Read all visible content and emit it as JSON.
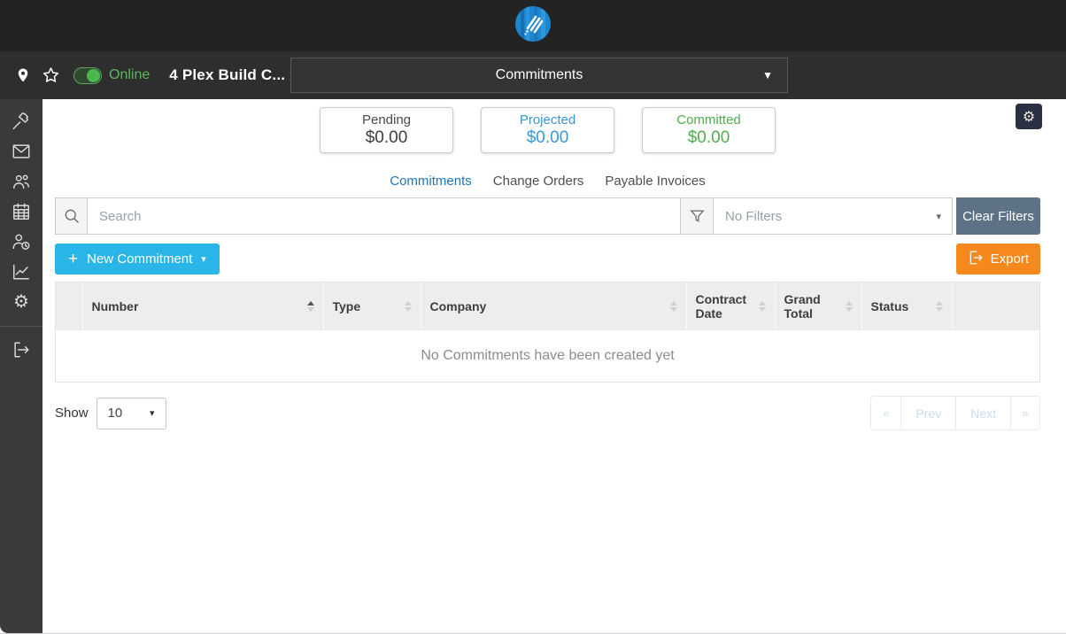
{
  "colors": {
    "topbar_bg": "#232323",
    "projectbar_bg": "#2e2e2e",
    "sidebar_bg": "#3a3a3a",
    "online_green": "#5cb85c",
    "projected_blue": "#3b97d3",
    "committed_green": "#50ad50",
    "active_tab_blue": "#1d76bd",
    "new_button_blue": "#29b5e8",
    "export_button_orange": "#f6891e",
    "clear_filters_slate": "#5d7285",
    "gear_button_navy": "#2a3142",
    "logo_blue": "#1e86cf"
  },
  "project_bar": {
    "online_label": "Online",
    "project_name": "4 Plex Build C...",
    "page_dropdown_value": "Commitments"
  },
  "sidebar": {
    "items": [
      {
        "icon": "hammer-icon"
      },
      {
        "icon": "mail-icon"
      },
      {
        "icon": "team-icon"
      },
      {
        "icon": "calendar-icon"
      },
      {
        "icon": "person-clock-icon"
      },
      {
        "icon": "chart-icon"
      },
      {
        "icon": "gear-icon"
      },
      {
        "icon": "logout-icon"
      }
    ],
    "gear_glyph": "⚙"
  },
  "header_actions": {
    "gear_glyph": "⚙"
  },
  "summary_cards": [
    {
      "label": "Pending",
      "value": "$0.00"
    },
    {
      "label": "Projected",
      "value": "$0.00"
    },
    {
      "label": "Committed",
      "value": "$0.00"
    }
  ],
  "tabs": [
    {
      "label": "Commitments",
      "active": true
    },
    {
      "label": "Change Orders",
      "active": false
    },
    {
      "label": "Payable Invoices",
      "active": false
    }
  ],
  "filter_bar": {
    "search_placeholder": "Search",
    "search_value": "",
    "filter_value": "No Filters",
    "clear_filters_label": "Clear Filters",
    "caret": "▾"
  },
  "actions": {
    "new_commitment_label": "New Commitment",
    "new_commitment_plus": "+",
    "new_commitment_caret": "▾",
    "export_label": "Export"
  },
  "table": {
    "columns": [
      {
        "label": "",
        "sort": "none"
      },
      {
        "label": "Number",
        "sort": "asc"
      },
      {
        "label": "Type",
        "sort": "unsorted"
      },
      {
        "label": "Company",
        "sort": "unsorted"
      },
      {
        "label": "Contract Date",
        "sort": "unsorted"
      },
      {
        "label": "Grand Total",
        "sort": "unsorted"
      },
      {
        "label": "Status",
        "sort": "unsorted"
      },
      {
        "label": "",
        "sort": "none"
      }
    ],
    "empty_message": "No Commitments have been created yet"
  },
  "pagination": {
    "show_label": "Show",
    "page_size": "10",
    "caret": "▾",
    "first_label": "«",
    "prev_label": "Prev",
    "next_label": "Next",
    "last_label": "»"
  }
}
